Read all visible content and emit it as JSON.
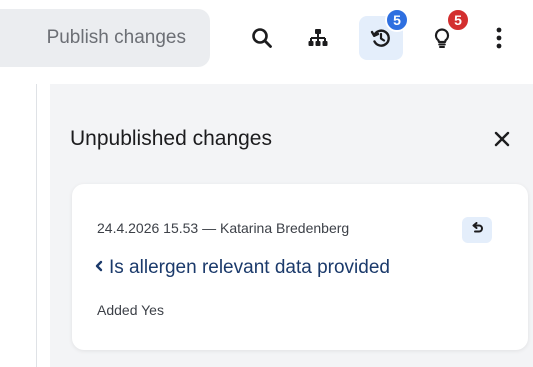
{
  "toolbar": {
    "publish_label": "Publish changes",
    "icons": [
      "search-icon",
      "hierarchy-icon",
      "history-icon",
      "lightbulb-icon",
      "more-vertical-icon"
    ],
    "history_badge": "5",
    "suggestions_badge": "5"
  },
  "panel": {
    "title": "Unpublished changes",
    "close_icon": "close-icon",
    "changes": [
      {
        "meta": "24.4.2026 15.53 — Katarina Bredenberg",
        "field": "Is allergen relevant data provided",
        "detail": "Added Yes"
      }
    ]
  },
  "colors": {
    "accent": "#e4eefb",
    "badge_blue": "#2e6fe0",
    "badge_red": "#d32f2f",
    "link": "#1b3a6b"
  }
}
